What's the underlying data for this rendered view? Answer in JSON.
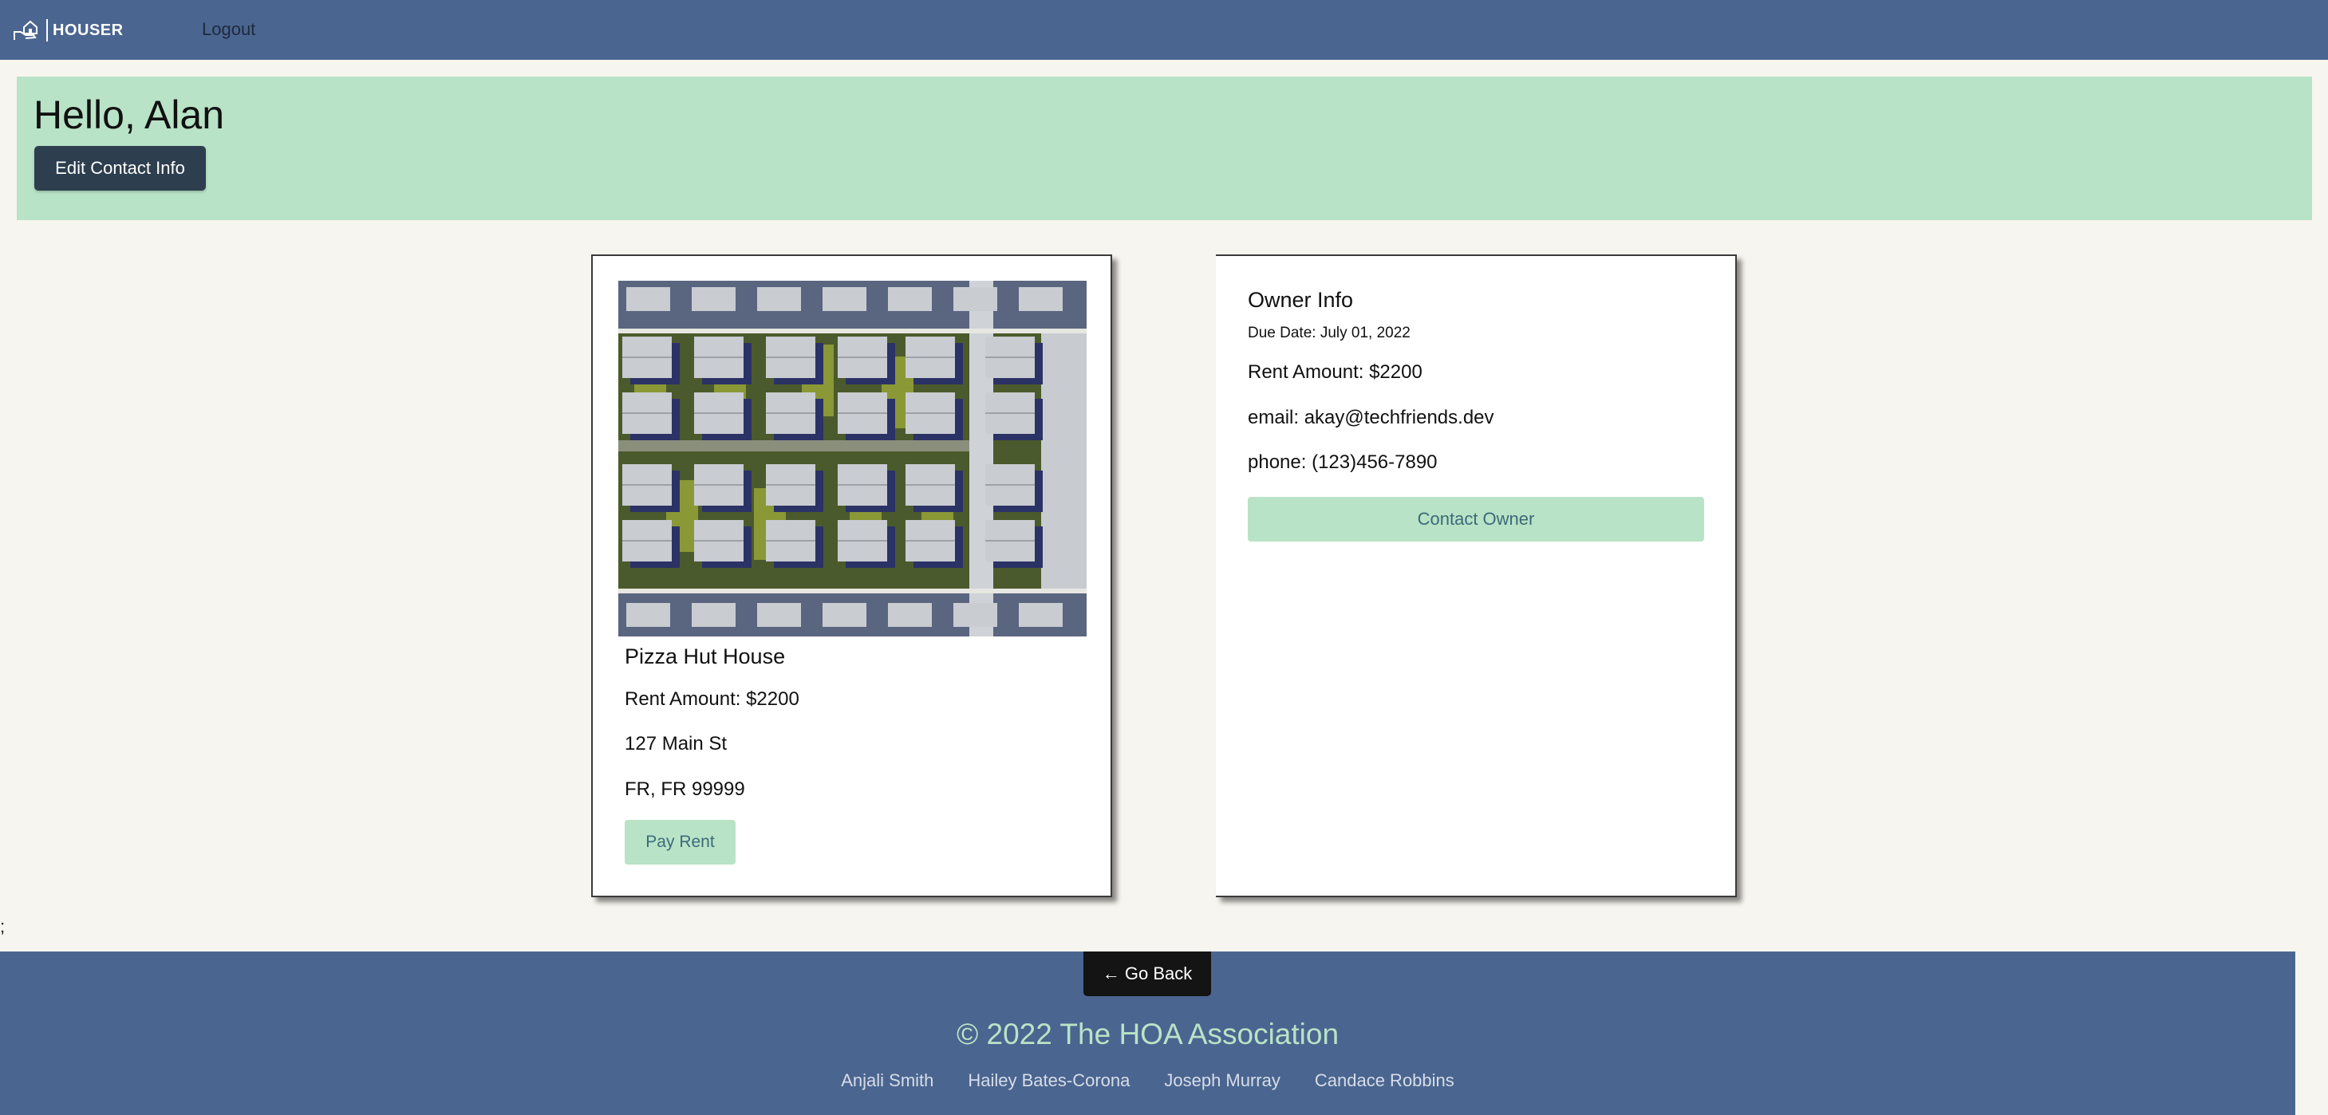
{
  "navbar": {
    "logo_text": "HOUSER",
    "logout_label": "Logout"
  },
  "banner": {
    "greeting": "Hello, Alan",
    "edit_button_label": "Edit Contact Info"
  },
  "property": {
    "name": "Pizza Hut House",
    "rent": "Rent Amount: $2200",
    "street": "127 Main St",
    "city_line": "FR, FR 99999",
    "pay_button_label": "Pay Rent",
    "image_icon": "aerial-neighborhood-photo"
  },
  "owner": {
    "title": "Owner Info",
    "due_date": "Due Date: July 01, 2022",
    "rent": "Rent Amount: $2200",
    "email": "email: akay@techfriends.dev",
    "phone": "phone: (123)456-7890",
    "contact_button_label": "Contact Owner"
  },
  "stray_text": ";",
  "footer": {
    "go_back_label": "← Go Back",
    "copyright": "© 2022 The HOA Association",
    "credits": [
      "Anjali Smith",
      "Hailey Bates-Corona",
      "Joseph Murray",
      "Candace Robbins"
    ]
  },
  "colors": {
    "navbar": "#4a6590",
    "banner": "#b9e3c6",
    "accent_button": "#b9e3c6",
    "dark_button": "#2d3e4f",
    "page_bg": "#f7f5ef"
  }
}
